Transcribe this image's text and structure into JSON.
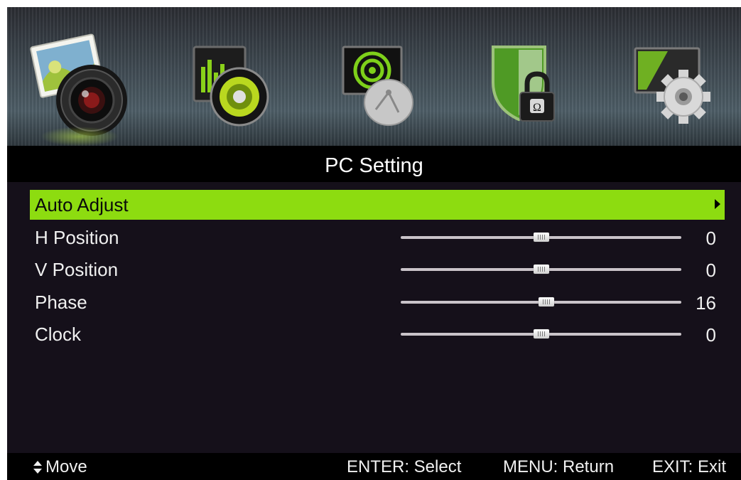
{
  "menu_tabs": [
    {
      "name": "picture",
      "icon": "picture-camera-icon",
      "selected": true
    },
    {
      "name": "sound",
      "icon": "speaker-equalizer-icon",
      "selected": false
    },
    {
      "name": "channel",
      "icon": "satellite-dish-icon",
      "selected": false
    },
    {
      "name": "lock",
      "icon": "shield-padlock-icon",
      "selected": false
    },
    {
      "name": "setup",
      "icon": "monitor-gear-icon",
      "selected": false
    }
  ],
  "page_title": "PC Setting",
  "items": [
    {
      "label": "Auto Adjust",
      "type": "submenu",
      "selected": true
    },
    {
      "label": "H Position",
      "type": "slider",
      "value": "0",
      "level": 0.5
    },
    {
      "label": "V Position",
      "type": "slider",
      "value": "0",
      "level": 0.5
    },
    {
      "label": "Phase",
      "type": "slider",
      "value": "16",
      "level": 0.52
    },
    {
      "label": "Clock",
      "type": "slider",
      "value": "0",
      "level": 0.5
    }
  ],
  "footer": {
    "move_icon": "up-down-arrows-icon",
    "move": "Move",
    "select": "ENTER: Select",
    "return": "MENU: Return",
    "exit": "EXIT: Exit"
  },
  "colors": {
    "highlight": "#8ddc10",
    "background": "#15101a",
    "bar": "#000000",
    "text": "#f0f0f0"
  }
}
